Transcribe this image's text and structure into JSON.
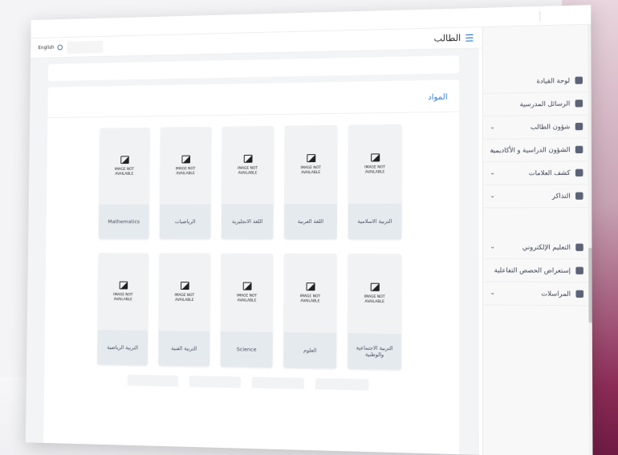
{
  "header": {
    "brand": "الطالب",
    "language": "English"
  },
  "sidebar": {
    "items": [
      {
        "label": "لوحة القيادة",
        "icon": "dashboard-icon",
        "chevron": false
      },
      {
        "label": "الرسائل المدرسية",
        "icon": "megaphone-icon",
        "chevron": false
      },
      {
        "label": "شؤون الطالب",
        "icon": "user-icon",
        "chevron": true
      },
      {
        "label": "الشؤون الدراسية و الأكاديمية",
        "icon": "briefcase-icon",
        "chevron": true
      },
      {
        "label": "كشف العلامات",
        "icon": "drop-icon",
        "chevron": true
      },
      {
        "label": "التذاكر",
        "icon": "laptop-icon",
        "chevron": true
      },
      {
        "label": "التعليم الإلكتروني",
        "icon": "graduation-cap-icon",
        "chevron": true
      },
      {
        "label": "إستعراض الحصص التفاعلية",
        "icon": "camera-icon",
        "chevron": false
      },
      {
        "label": "المراسلات",
        "icon": "envelope-icon",
        "chevron": true
      }
    ]
  },
  "main": {
    "section_title": "المواد",
    "image_placeholder_line1": "IMAGE NOT",
    "image_placeholder_line2": "AVAILABLE",
    "subjects_row1": [
      "التربية الاسلامية",
      "اللغة العربية",
      "اللغة الانجليزية",
      "الرياضيات",
      "Mathematics"
    ],
    "subjects_row2": [
      "التربية الاجتماعية والوطنية",
      "العلوم",
      "Science",
      "التربية الفنية",
      "التربية الرياضية"
    ]
  },
  "colors": {
    "accent": "#2f7fd9",
    "brand_maroon": "#8b2b56"
  }
}
